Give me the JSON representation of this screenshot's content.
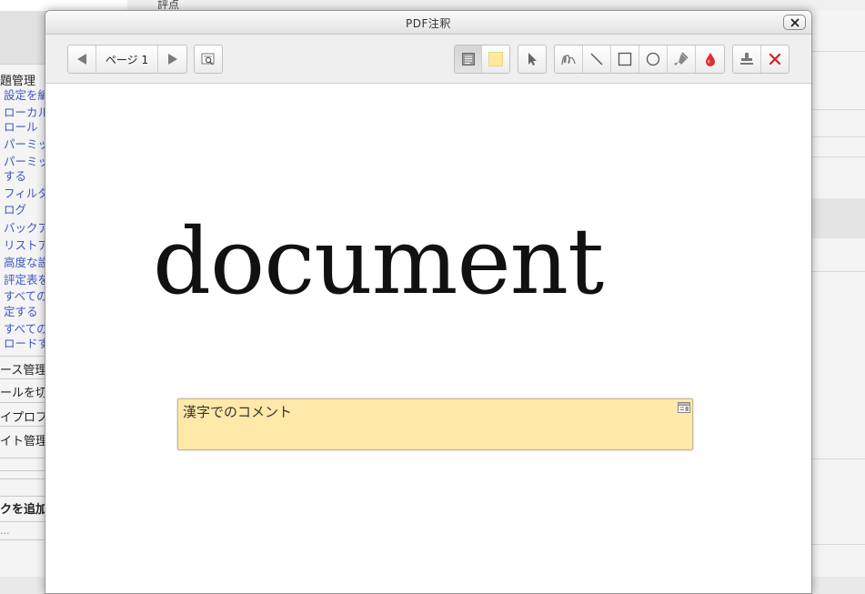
{
  "background": {
    "top_text": "評点",
    "sidebar_heading": "題管理",
    "sidebar_links": [
      "設定を編",
      "ローカル",
      "ロール",
      "パーミッ",
      "パーミッ",
      "する",
      "フィルタ",
      "ログ",
      "バックア",
      "リストア",
      "高度な設",
      "評定表を",
      "すべての",
      "定する",
      "すべての",
      "ロードす"
    ],
    "sidebar_sections": [
      "ース管理",
      "ールを切",
      "イプロファ",
      "イト管理"
    ],
    "add_block": "クを追加",
    "ellipsis": "..."
  },
  "dialog": {
    "title": "PDF注釈",
    "page_label": "ページ 1",
    "document_text": "document",
    "comment_text": "漢字でのコメント",
    "colors": {
      "comment_bg": "#ffe9a9",
      "yellow_swatch": "#ffe99a",
      "delete_red": "#d62020",
      "ink_red": "#e03030"
    },
    "tools": [
      "prev-page",
      "next-page",
      "search-comments",
      "comment-list",
      "color-picker",
      "select",
      "pen",
      "line",
      "rectangle",
      "oval",
      "highlight",
      "color",
      "stamp",
      "delete"
    ]
  }
}
